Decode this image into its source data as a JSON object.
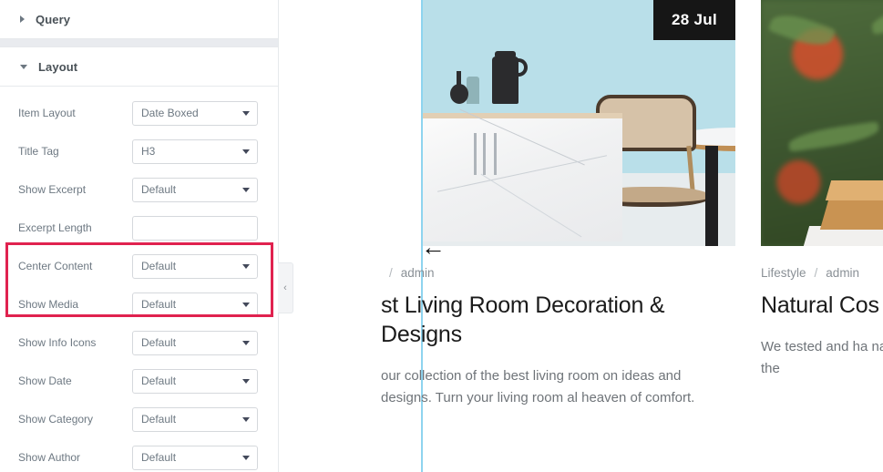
{
  "panel": {
    "sections": [
      {
        "name": "query",
        "title": "Query",
        "expanded": false,
        "icon": "triangle-right-icon"
      },
      {
        "name": "layout",
        "title": "Layout",
        "expanded": true,
        "icon": "triangle-down-icon"
      }
    ],
    "controls": [
      {
        "label": "Item Layout",
        "value": "Date Boxed",
        "type": "select",
        "highlighted": false
      },
      {
        "label": "Title Tag",
        "value": "H3",
        "type": "select",
        "highlighted": false
      },
      {
        "label": "Show Excerpt",
        "value": "Default",
        "type": "select",
        "highlighted": false
      },
      {
        "label": "Excerpt Length",
        "value": "",
        "type": "text",
        "highlighted": false
      },
      {
        "label": "Center Content",
        "value": "Default",
        "type": "select",
        "highlighted": true
      },
      {
        "label": "Show Media",
        "value": "Default",
        "type": "select",
        "highlighted": true
      },
      {
        "label": "Show Info Icons",
        "value": "Default",
        "type": "select",
        "highlighted": false
      },
      {
        "label": "Show Date",
        "value": "Default",
        "type": "select",
        "highlighted": false
      },
      {
        "label": "Show Category",
        "value": "Default",
        "type": "select",
        "highlighted": false
      },
      {
        "label": "Show Author",
        "value": "Default",
        "type": "select",
        "highlighted": false
      }
    ],
    "highlight_color": "#e0224f",
    "collapse_handle": {
      "icon": "chevron-left-icon",
      "glyph": "‹"
    }
  },
  "preview": {
    "cursor": {
      "icon": "arrow-left-cursor-icon",
      "glyph": "←"
    },
    "cards": [
      {
        "date_badge": "28 Jul",
        "category": "",
        "separator": "/",
        "author": "admin",
        "title": "st Living Room Decoration & Designs",
        "excerpt": "our collection of the best living room on ideas and designs. Turn your living room al heaven of comfort.",
        "image": "living-room-photo"
      },
      {
        "date_badge": "",
        "category": "Lifestyle",
        "separator": "/",
        "author": "admin",
        "title": "Natural Cos Skin Types",
        "excerpt": "We tested and ha natural, cruelty-fr Glow up with the",
        "image": "cosmetics-bottle-photo"
      }
    ]
  }
}
